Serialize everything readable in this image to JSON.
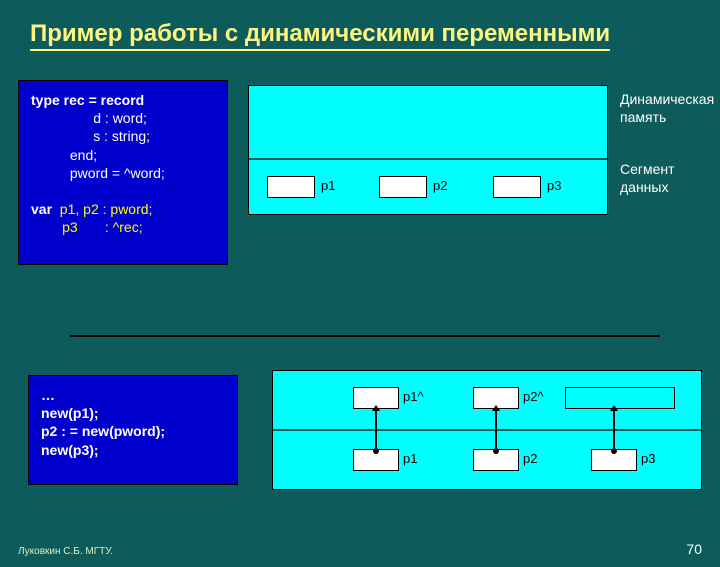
{
  "title": "Пример работы с динамическими переменными",
  "code1": {
    "l1": "type rec = record",
    "l2": "                d : word;",
    "l3": "                s : string;",
    "l4": "          end;",
    "l5": "          pword = ^word;",
    "l7": "var  p1, p2 : pword;",
    "l7a": "var",
    "l7b": "  p1, p2 : pword;",
    "l8": "        p3       : ^rec;"
  },
  "code2": {
    "l1": "…",
    "l2": "new(p1);",
    "l3": "p2 : = new(pword);",
    "l4": "new(p3);"
  },
  "labels": {
    "dynmem": "Динамическая память",
    "dataseg": "Сегмент данных",
    "p1": "p1",
    "p2": "p2",
    "p3": "p3",
    "p1caret": "p1^",
    "p2caret": "p2^"
  },
  "footer": "Луковкин С.Б. МГТУ.",
  "page": "70",
  "chart_data": [
    {
      "type": "diagram",
      "title": "Memory segments before allocation",
      "regions": [
        {
          "name": "Динамическая память",
          "cells": []
        },
        {
          "name": "Сегмент данных",
          "cells": [
            "p1",
            "p2",
            "p3"
          ]
        }
      ]
    },
    {
      "type": "diagram",
      "title": "After new() allocation",
      "heap_cells": [
        "p1^",
        "p2^",
        ""
      ],
      "data_cells": [
        "p1",
        "p2",
        "p3"
      ],
      "arrows": [
        {
          "from": "p1",
          "to": "p1^"
        },
        {
          "from": "p2",
          "to": "p2^"
        },
        {
          "from": "p3",
          "to": ""
        }
      ]
    }
  ]
}
